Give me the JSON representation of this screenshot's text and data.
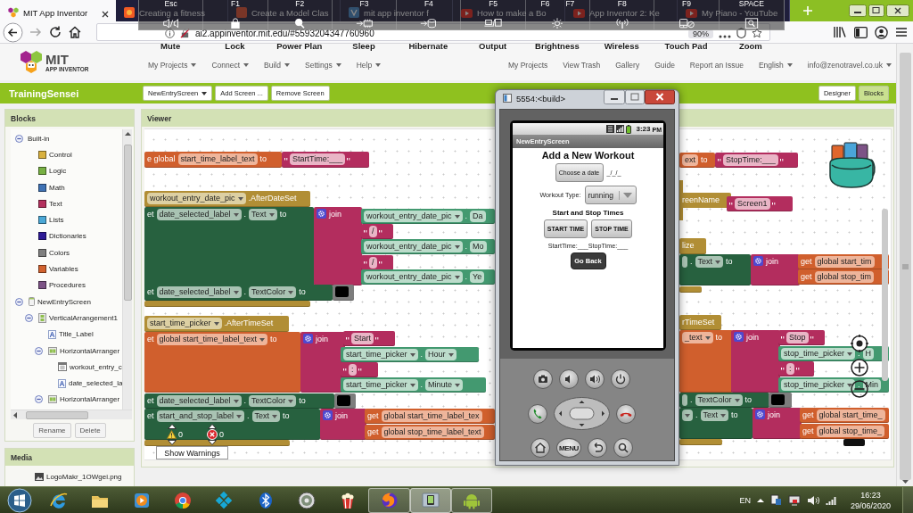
{
  "browser": {
    "tabs": [
      {
        "title": "MIT App Inventor",
        "selected": true
      },
      {
        "title": "Creating a fitness",
        "selected": false
      },
      {
        "title": "Create a Model Clas",
        "selected": false
      },
      {
        "title": "mit app inventor f",
        "selected": false
      },
      {
        "title": "How to make a Bo",
        "selected": false
      },
      {
        "title": "App Inventor 2: Ke",
        "selected": false
      },
      {
        "title": "My Piano - YouTube",
        "selected": false
      }
    ],
    "address": "ai2.appinventor.mit.edu/#5593204347760960",
    "zoom": "90%"
  },
  "key_overlay": [
    {
      "keys": [
        "Esc"
      ],
      "action": "Mute"
    },
    {
      "keys": [
        "F1"
      ],
      "action": "Lock"
    },
    {
      "keys": [
        "F2"
      ],
      "action": "Power Plan"
    },
    {
      "keys": [
        "F3"
      ],
      "action": "Sleep"
    },
    {
      "keys": [
        "F4"
      ],
      "action": "Hibernate"
    },
    {
      "keys": [
        "F5"
      ],
      "action": "Output"
    },
    {
      "keys": [
        "F6",
        "F7"
      ],
      "action": "Brightness"
    },
    {
      "keys": [
        "F8"
      ],
      "action": "Wireless"
    },
    {
      "keys": [
        "F9"
      ],
      "action": "Touch Pad"
    },
    {
      "keys": [
        "SPACE"
      ],
      "action": "Zoom"
    }
  ],
  "header": {
    "logo": {
      "title": "MIT",
      "subtitle": "APP INVENTOR"
    },
    "menu": [
      "My Projects",
      "Connect",
      "Build",
      "Settings",
      "Help"
    ],
    "links": [
      "My Projects",
      "View Trash",
      "Gallery",
      "Guide",
      "Report an Issue"
    ],
    "language": "English",
    "account": "info@zenotravel.co.uk"
  },
  "project_bar": {
    "title": "TrainingSensei",
    "screen": "NewEntryScreen",
    "buttons": [
      "Add Screen ...",
      "Remove Screen"
    ],
    "views": [
      {
        "label": "Designer",
        "selected": false
      },
      {
        "label": "Blocks",
        "selected": true
      }
    ]
  },
  "blocks_panel": {
    "title": "Blocks",
    "tree": [
      {
        "label": "Built-in",
        "kind": "group",
        "expanded": true,
        "children": [
          {
            "label": "Control",
            "kind": "builtin",
            "color": "#d9b13e"
          },
          {
            "label": "Logic",
            "kind": "builtin",
            "color": "#77b043"
          },
          {
            "label": "Math",
            "kind": "builtin",
            "color": "#3e71b4"
          },
          {
            "label": "Text",
            "kind": "builtin",
            "color": "#b4305e"
          },
          {
            "label": "Lists",
            "kind": "builtin",
            "color": "#4aa7d6"
          },
          {
            "label": "Dictionaries",
            "kind": "builtin",
            "color": "#2d1a96"
          },
          {
            "label": "Colors",
            "kind": "builtin",
            "color": "#7f7f7f"
          },
          {
            "label": "Variables",
            "kind": "builtin",
            "color": "#d2622f"
          },
          {
            "label": "Procedures",
            "kind": "builtin",
            "color": "#7d5386"
          }
        ]
      },
      {
        "label": "NewEntryScreen",
        "kind": "screen",
        "expanded": true,
        "children": [
          {
            "label": "VerticalArrangement1",
            "kind": "vertical",
            "expanded": true,
            "children": [
              {
                "label": "Title_Label",
                "kind": "label"
              },
              {
                "label": "HorizontalArranger",
                "kind": "horizontal",
                "expanded": true,
                "children": [
                  {
                    "label": "workout_entry_c",
                    "kind": "datepicker"
                  },
                  {
                    "label": "date_selected_la",
                    "kind": "label"
                  }
                ]
              },
              {
                "label": "HorizontalArranger",
                "kind": "horizontal",
                "expanded": true
              }
            ]
          }
        ]
      }
    ],
    "buttons": [
      "Rename",
      "Delete"
    ]
  },
  "media_panel": {
    "title": "Media",
    "files": [
      "LogoMakr_1OWgei.png"
    ]
  },
  "viewer": {
    "title": "Viewer",
    "blocks": [
      {
        "kind": "variable",
        "parts": [
          {
            "kind": "label",
            "text": "e global"
          },
          {
            "kind": "field",
            "text": "start_time_label_text",
            "dropdown": false
          },
          {
            "kind": "label",
            "text": "to"
          }
        ]
      },
      {
        "kind": "text",
        "parts": [
          {
            "kind": "string",
            "text": "StartTime:___"
          }
        ]
      },
      {
        "kind": "event",
        "parts": [
          {
            "kind": "field",
            "text": "workout_entry_date_pic",
            "dropdown": true
          },
          {
            "kind": "label",
            "text": ".AfterDateSet"
          }
        ]
      },
      {
        "kind": "component_set",
        "parts": [
          {
            "kind": "label",
            "text": "et"
          },
          {
            "kind": "field",
            "text": "date_selected_label",
            "dropdown": true
          },
          {
            "kind": "label",
            "text": "."
          },
          {
            "kind": "field",
            "text": "Text",
            "dropdown": true
          },
          {
            "kind": "label",
            "text": "to"
          }
        ]
      },
      {
        "kind": "join",
        "parts": [
          {
            "kind": "gear"
          },
          {
            "kind": "label",
            "text": "join"
          }
        ]
      },
      {
        "kind": "component_get",
        "parts": [
          {
            "kind": "field",
            "text": "workout_entry_date_pic",
            "dropdown": true
          },
          {
            "kind": "label",
            "text": "."
          },
          {
            "kind": "field",
            "text": "Da",
            "dropdown": false
          }
        ]
      },
      {
        "kind": "text",
        "parts": [
          {
            "kind": "string",
            "text": "/"
          }
        ]
      },
      {
        "kind": "component_get",
        "parts": [
          {
            "kind": "field",
            "text": "workout_entry_date_pic",
            "dropdown": true
          },
          {
            "kind": "label",
            "text": "."
          },
          {
            "kind": "field",
            "text": "Mo",
            "dropdown": false
          }
        ]
      },
      {
        "kind": "text",
        "parts": [
          {
            "kind": "string",
            "text": "/"
          }
        ]
      },
      {
        "kind": "component_get",
        "parts": [
          {
            "kind": "field",
            "text": "workout_entry_date_pic",
            "dropdown": true
          },
          {
            "kind": "label",
            "text": "."
          },
          {
            "kind": "field",
            "text": "Ye",
            "dropdown": false
          }
        ]
      },
      {
        "kind": "component_set",
        "parts": [
          {
            "kind": "label",
            "text": "et"
          },
          {
            "kind": "field",
            "text": "date_selected_label",
            "dropdown": true
          },
          {
            "kind": "label",
            "text": "."
          },
          {
            "kind": "field",
            "text": "TextColor",
            "dropdown": true
          },
          {
            "kind": "label",
            "text": "to"
          }
        ]
      },
      {
        "kind": "color",
        "parts": [
          {
            "kind": "swatch",
            "color": "#000000"
          }
        ]
      },
      {
        "kind": "event_end"
      },
      {
        "kind": "event",
        "parts": [
          {
            "kind": "field",
            "text": "start_time_picker",
            "dropdown": true
          },
          {
            "kind": "label",
            "text": ".AfterTimeSet"
          }
        ]
      },
      {
        "kind": "variable",
        "parts": [
          {
            "kind": "label",
            "text": "et"
          },
          {
            "kind": "field",
            "text": "global start_time_label_text",
            "dropdown": true
          },
          {
            "kind": "label",
            "text": "to"
          }
        ]
      },
      {
        "kind": "join",
        "parts": [
          {
            "kind": "gear"
          },
          {
            "kind": "label",
            "text": "join"
          }
        ]
      },
      {
        "kind": "text",
        "parts": [
          {
            "kind": "string",
            "text": "Start"
          }
        ]
      },
      {
        "kind": "component_get",
        "parts": [
          {
            "kind": "field",
            "text": "start_time_picker",
            "dropdown": true
          },
          {
            "kind": "label",
            "text": "."
          },
          {
            "kind": "field",
            "text": "Hour",
            "dropdown": true
          }
        ]
      },
      {
        "kind": "text",
        "parts": [
          {
            "kind": "string",
            "text": ":"
          }
        ]
      },
      {
        "kind": "component_get",
        "parts": [
          {
            "kind": "field",
            "text": "start_time_picker",
            "dropdown": true
          },
          {
            "kind": "label",
            "text": "."
          },
          {
            "kind": "field",
            "text": "Minute",
            "dropdown": true
          }
        ]
      },
      {
        "kind": "component_set",
        "parts": [
          {
            "kind": "label",
            "text": "et"
          },
          {
            "kind": "field",
            "text": "date_selected_label",
            "dropdown": true
          },
          {
            "kind": "label",
            "text": "."
          },
          {
            "kind": "field",
            "text": "TextColor",
            "dropdown": true
          },
          {
            "kind": "label",
            "text": "to"
          }
        ]
      },
      {
        "kind": "color",
        "parts": [
          {
            "kind": "swatch",
            "color": "#000000"
          }
        ]
      },
      {
        "kind": "component_set",
        "parts": [
          {
            "kind": "label",
            "text": "et"
          },
          {
            "kind": "field",
            "text": "start_and_stop_label",
            "dropdown": true
          },
          {
            "kind": "label",
            "text": "."
          },
          {
            "kind": "field",
            "text": "Text",
            "dropdown": true
          },
          {
            "kind": "label",
            "text": "to"
          }
        ]
      },
      {
        "kind": "join",
        "parts": [
          {
            "kind": "gear"
          },
          {
            "kind": "label",
            "text": "join"
          }
        ]
      },
      {
        "kind": "variable",
        "parts": [
          {
            "kind": "label",
            "text": "get"
          },
          {
            "kind": "field",
            "text": "global start_time_label_tex",
            "dropdown": false
          }
        ]
      },
      {
        "kind": "variable",
        "parts": [
          {
            "kind": "label",
            "text": "get"
          },
          {
            "kind": "field",
            "text": "global stop_time_label_text",
            "dropdown": false
          }
        ]
      },
      {
        "kind": "event_end"
      },
      {
        "kind": "variable",
        "parts": [
          {
            "kind": "field",
            "text": "ext",
            "dropdown": false
          },
          {
            "kind": "label",
            "text": "to"
          }
        ]
      },
      {
        "kind": "text",
        "parts": [
          {
            "kind": "string",
            "text": "StopTime:___"
          }
        ]
      },
      {
        "kind": "event",
        "parts": [
          {
            "kind": "label",
            "text": "reenName"
          }
        ]
      },
      {
        "kind": "text",
        "parts": [
          {
            "kind": "string",
            "text": "Screen1"
          }
        ]
      },
      {
        "kind": "event",
        "parts": [
          {
            "kind": "label",
            "text": "lize"
          }
        ]
      },
      {
        "kind": "component_set",
        "parts": [
          {
            "kind": "field",
            "dropdown": false
          },
          {
            "kind": "label",
            "text": "."
          },
          {
            "kind": "field",
            "text": "Text",
            "dropdown": true
          },
          {
            "kind": "label",
            "text": "to"
          }
        ]
      },
      {
        "kind": "join",
        "parts": [
          {
            "kind": "gear"
          },
          {
            "kind": "label",
            "text": "join"
          }
        ]
      },
      {
        "kind": "variable",
        "parts": [
          {
            "kind": "label",
            "text": "get"
          },
          {
            "kind": "field",
            "text": "global start_tim",
            "dropdown": false
          }
        ]
      },
      {
        "kind": "variable",
        "parts": [
          {
            "kind": "label",
            "text": "get"
          },
          {
            "kind": "field",
            "text": "global stop_tim",
            "dropdown": false
          }
        ]
      },
      {
        "kind": "event_end"
      },
      {
        "kind": "event",
        "parts": [
          {
            "kind": "label",
            "text": "rTimeSet"
          }
        ]
      },
      {
        "kind": "variable",
        "parts": [
          {
            "kind": "field",
            "text": "_text",
            "dropdown": true
          },
          {
            "kind": "label",
            "text": "to"
          }
        ]
      },
      {
        "kind": "join",
        "parts": [
          {
            "kind": "gear"
          },
          {
            "kind": "label",
            "text": "join"
          }
        ]
      },
      {
        "kind": "text",
        "parts": [
          {
            "kind": "string",
            "text": "Stop"
          }
        ]
      },
      {
        "kind": "component_get",
        "parts": [
          {
            "kind": "field",
            "text": "stop_time_picker",
            "dropdown": true
          },
          {
            "kind": "label",
            "text": "."
          },
          {
            "kind": "field",
            "text": "H",
            "dropdown": false
          }
        ]
      },
      {
        "kind": "text",
        "parts": [
          {
            "kind": "string",
            "text": ":"
          }
        ]
      },
      {
        "kind": "component_get",
        "parts": [
          {
            "kind": "field",
            "text": "stop_time_picker",
            "dropdown": true
          },
          {
            "kind": "label",
            "text": "."
          },
          {
            "kind": "field",
            "text": "Min",
            "dropdown": false
          }
        ]
      },
      {
        "kind": "component_set",
        "parts": [
          {
            "kind": "field",
            "dropdown": false
          },
          {
            "kind": "label",
            "text": "."
          },
          {
            "kind": "field",
            "text": "TextColor",
            "dropdown": true
          },
          {
            "kind": "label",
            "text": "to"
          }
        ]
      },
      {
        "kind": "color",
        "parts": [
          {
            "kind": "swatch",
            "color": "#000000"
          }
        ]
      },
      {
        "kind": "component_set",
        "parts": [
          {
            "kind": "field",
            "dropdown": true
          },
          {
            "kind": "label",
            "text": "."
          },
          {
            "kind": "field",
            "text": "Text",
            "dropdown": true
          },
          {
            "kind": "label",
            "text": "to"
          }
        ]
      },
      {
        "kind": "join",
        "parts": [
          {
            "kind": "gear"
          },
          {
            "kind": "label",
            "text": "join"
          }
        ]
      },
      {
        "kind": "variable",
        "parts": [
          {
            "kind": "label",
            "text": "get"
          },
          {
            "kind": "field",
            "text": "global start_time_",
            "dropdown": false
          }
        ]
      },
      {
        "kind": "variable",
        "parts": [
          {
            "kind": "label",
            "text": "get"
          },
          {
            "kind": "field",
            "text": "global stop_time_",
            "dropdown": false
          }
        ]
      },
      {
        "kind": "event_end"
      },
      {
        "kind": "fragment",
        "color": "#111111"
      }
    ],
    "warnings": {
      "warning_count": "0",
      "error_count": "0",
      "button": "Show Warnings"
    }
  },
  "emulator": {
    "title": "5554:<build>",
    "status_time": "3:23",
    "status_ampm": "PM",
    "screen_title": "NewEntryScreen",
    "heading": "Add a New Workout",
    "date_button": "Choose a date",
    "date_value": "_/_/_",
    "type_label": "Workout Type:",
    "type_value": "running",
    "times_heading": "Start and Stop Times",
    "time_buttons": [
      "START TIME",
      "STOP TIME"
    ],
    "times_value": "StartTime:___StopTime:___",
    "back_button": "Go Back",
    "menu_key": "MENU"
  },
  "taskbar": {
    "apps": [
      {
        "running": false,
        "selected": false
      },
      {
        "running": false,
        "selected": false
      },
      {
        "running": false,
        "selected": false
      },
      {
        "running": false,
        "selected": false
      },
      {
        "running": false,
        "selected": false
      },
      {
        "running": false,
        "selected": false
      },
      {
        "running": false,
        "selected": false
      },
      {
        "running": false,
        "selected": false
      },
      {
        "running": true,
        "selected": false
      },
      {
        "running": true,
        "selected": true
      },
      {
        "running": true,
        "selected": false
      }
    ],
    "language": "EN",
    "time": "16:23",
    "date": "29/06/2020"
  }
}
